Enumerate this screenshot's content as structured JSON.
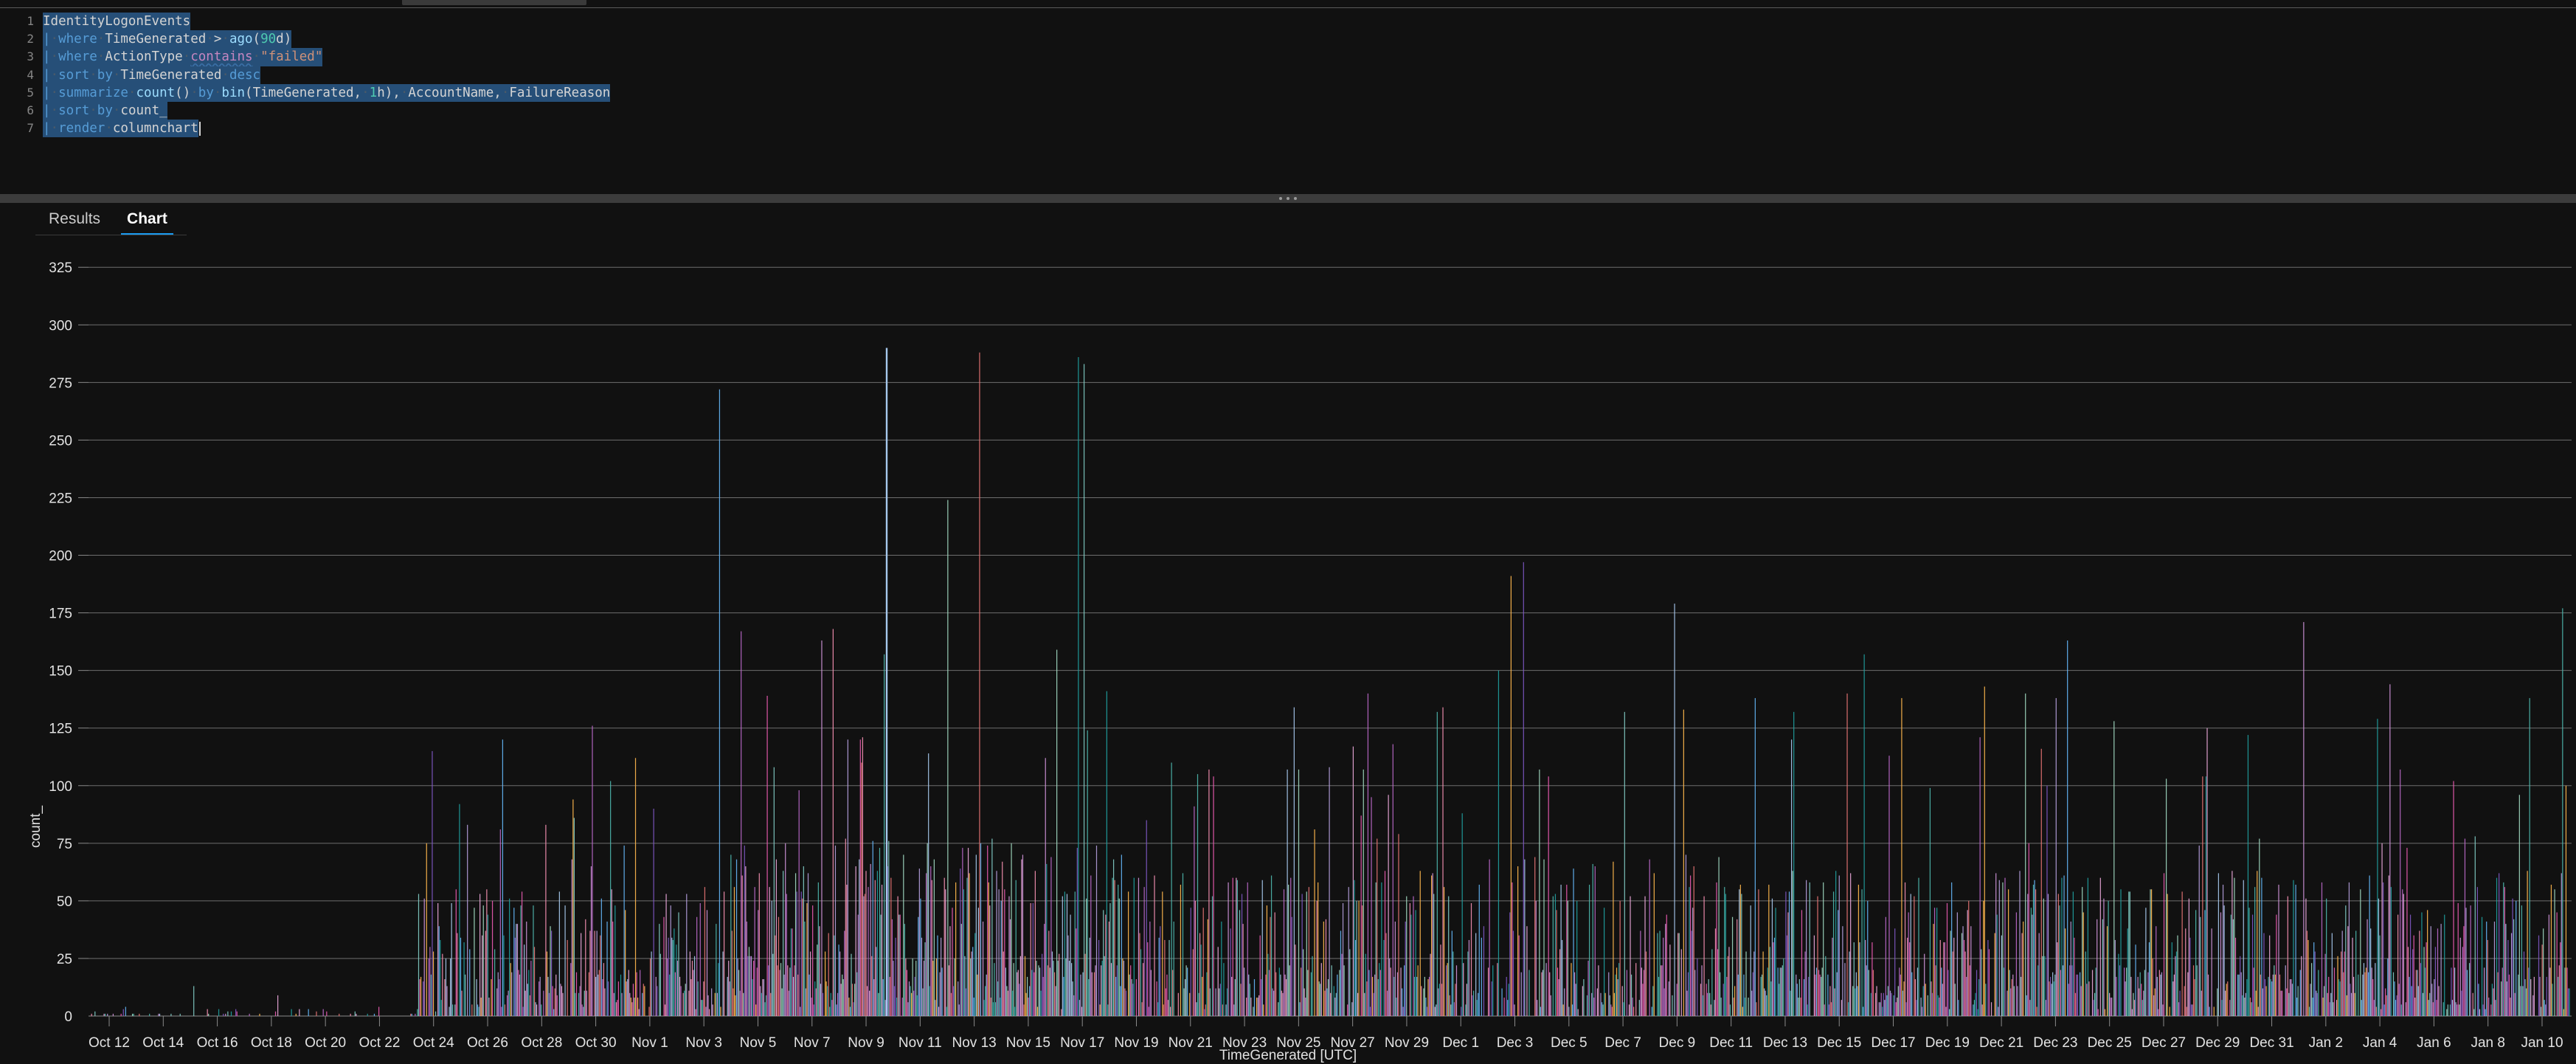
{
  "window": {
    "background": "#111111",
    "top_stub": "tab-strip-remnant"
  },
  "editor": {
    "language": "kql",
    "selection_color": "#264f78",
    "lines": [
      {
        "number": "1",
        "text": "IdentityLogonEvents"
      },
      {
        "number": "2",
        "text": "| where TimeGenerated > ago(90d)"
      },
      {
        "number": "3",
        "text": "| where ActionType contains \"failed\""
      },
      {
        "number": "4",
        "text": "| sort by TimeGenerated desc"
      },
      {
        "number": "5",
        "text": "| summarize count() by bin(TimeGenerated, 1h), AccountName, FailureReason"
      },
      {
        "number": "6",
        "text": "| sort by count_"
      },
      {
        "number": "7",
        "text": "| render columnchart"
      }
    ]
  },
  "splitter": {
    "handle": "resize-dots"
  },
  "results": {
    "tabs": [
      {
        "label": "Results",
        "active": false
      },
      {
        "label": "Chart",
        "active": true
      }
    ]
  },
  "chart_data": {
    "type": "bar",
    "title": "",
    "subtitle": "",
    "xlabel": "TimeGenerated [UTC]",
    "ylabel": "count_",
    "ylim": [
      0,
      335
    ],
    "yticks": [
      0,
      25,
      50,
      75,
      100,
      125,
      150,
      175,
      200,
      225,
      250,
      275,
      300,
      325
    ],
    "ytick_labels": [
      "0",
      "25",
      "50",
      "75",
      "100",
      "125",
      "150",
      "175",
      "200",
      "225",
      "250",
      "275",
      "300",
      "325"
    ],
    "grid": true,
    "grid_axis": "y",
    "legend": "none",
    "x_type": "datetime",
    "x_range": [
      "Oct 11",
      "Jan 10"
    ],
    "xtick_labels": [
      "Oct 12",
      "Oct 14",
      "Oct 16",
      "Oct 18",
      "Oct 20",
      "Oct 22",
      "Oct 24",
      "Oct 26",
      "Oct 28",
      "Oct 30",
      "Nov 1",
      "Nov 3",
      "Nov 5",
      "Nov 7",
      "Nov 9",
      "Nov 11",
      "Nov 13",
      "Nov 15",
      "Nov 17",
      "Nov 19",
      "Nov 21",
      "Nov 23",
      "Nov 25",
      "Nov 27",
      "Nov 29",
      "Dec 1",
      "Dec 3",
      "Dec 5",
      "Dec 7",
      "Dec 9",
      "Dec 11",
      "Dec 13",
      "Dec 15",
      "Dec 17",
      "Dec 19",
      "Dec 21",
      "Dec 23",
      "Dec 25",
      "Dec 27",
      "Dec 29",
      "Dec 31",
      "Jan 2",
      "Jan 4",
      "Jan 6",
      "Jan 8",
      "Jan 10"
    ],
    "bin_size": "1h",
    "max_value": 290,
    "series_palette": [
      "#a6c8ed",
      "#e8a6d8",
      "#b39ddb",
      "#1f9e9e",
      "#9fd8c0",
      "#e85ab0",
      "#7e57c2",
      "#4db6ac",
      "#ffb74d",
      "#e57373",
      "#64b5f6",
      "#ba68c8",
      "#80cbc4",
      "#f48fb1",
      "#ce93d8"
    ],
    "note": "Hourly failed-logon counts per AccountName/FailureReason; hundreds of thin stacked-by-hour columns spanning Oct 11 to Jan 10. Activity is near zero until ~Oct 23, dense and high through Nov-Dec, with the tallest column ~290 around Nov 9.",
    "density_profile": [
      {
        "from": "Oct 11",
        "to": "Oct 23",
        "typical": 3,
        "peak": 14,
        "density": 0.18
      },
      {
        "from": "Oct 23",
        "to": "Nov 3",
        "typical": 40,
        "peak": 150,
        "density": 0.8
      },
      {
        "from": "Nov 3",
        "to": "Nov 18",
        "typical": 55,
        "peak": 290,
        "density": 0.95
      },
      {
        "from": "Nov 18",
        "to": "Dec 1",
        "typical": 45,
        "peak": 140,
        "density": 0.85
      },
      {
        "from": "Dec 1",
        "to": "Dec 10",
        "typical": 50,
        "peak": 210,
        "density": 0.7
      },
      {
        "from": "Dec 10",
        "to": "Jan 10",
        "typical": 45,
        "peak": 190,
        "density": 0.88
      }
    ]
  }
}
